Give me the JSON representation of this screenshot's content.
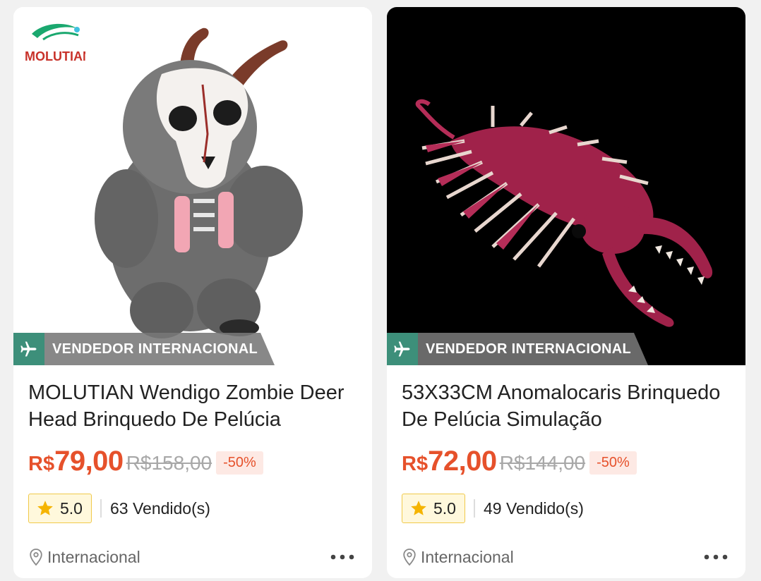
{
  "products": [
    {
      "badge": "VENDEDOR INTERNACIONAL",
      "brand_logo_text": "MOLUTIAN",
      "title": "MOLUTIAN Wendigo Zombie Deer Head Brinquedo De Pelúcia",
      "currency": "R$",
      "price": "79,00",
      "old_price": "R$158,00",
      "discount": "-50%",
      "rating": "5.0",
      "sold": "63 Vendido(s)",
      "location": "Internacional"
    },
    {
      "badge": "VENDEDOR INTERNACIONAL",
      "title": "53X33CM Anomalocaris Brinquedo De Pelúcia Simulação",
      "currency": "R$",
      "price": "72,00",
      "old_price": "R$144,00",
      "discount": "-50%",
      "rating": "5.0",
      "sold": "49 Vendido(s)",
      "location": "Internacional"
    }
  ],
  "icons": {
    "badge": "airplane-icon",
    "rating": "star-icon",
    "location": "location-pin-icon",
    "more": "more-options-icon"
  },
  "colors": {
    "price": "#e6512b",
    "badge_icon_bg": "#3d8f7a",
    "badge_bg": "#787878",
    "rating_star": "#f5b400",
    "discount_bg": "#fde9e4"
  }
}
